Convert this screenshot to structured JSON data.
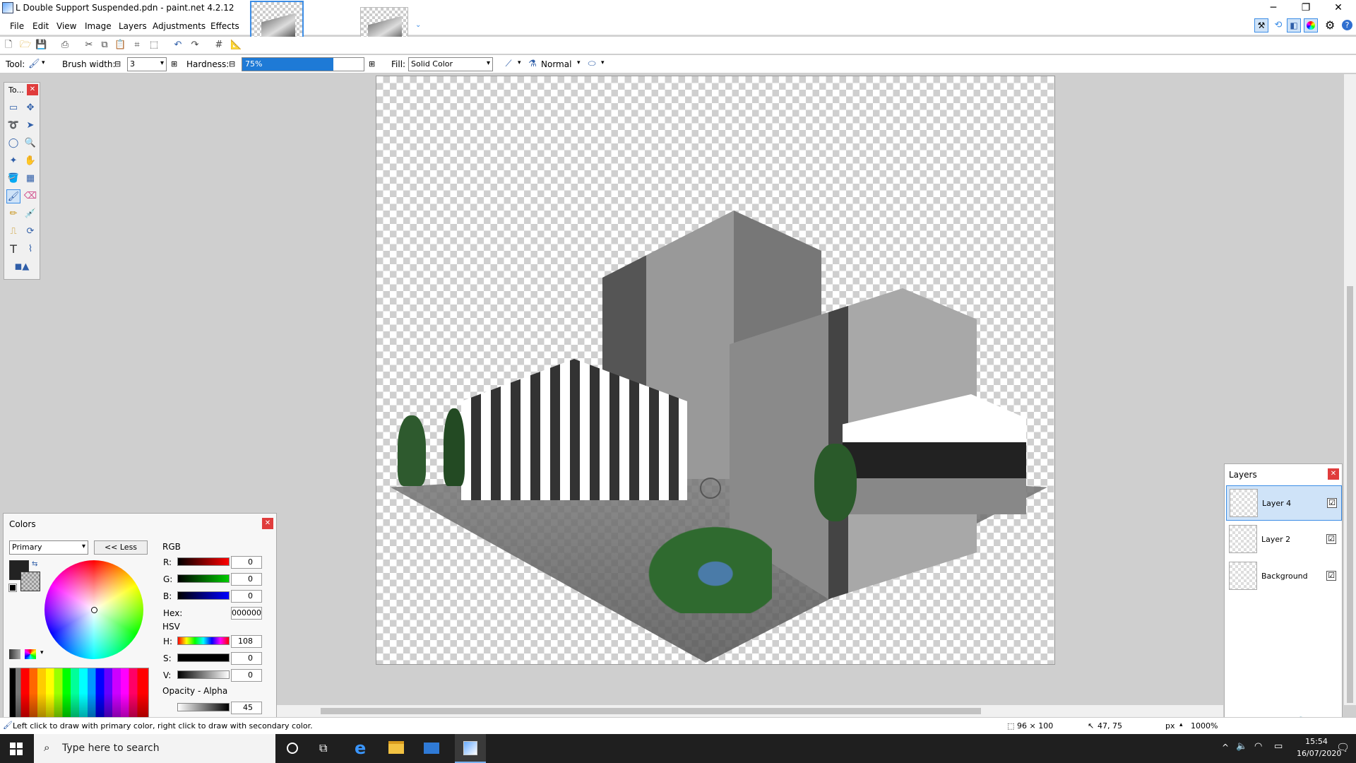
{
  "window": {
    "title": "L Double Support Suspended.pdn - paint.net 4.2.12",
    "min": "─",
    "max": "❐",
    "close": "✕"
  },
  "menu": [
    "File",
    "Edit",
    "View",
    "Image",
    "Layers",
    "Adjustments",
    "Effects"
  ],
  "toolbar": {
    "tool_label": "Tool:",
    "brush_width_label": "Brush width:",
    "brush_width_value": "3",
    "hardness_label": "Hardness:",
    "hardness_value": "75%",
    "hardness_fraction": 0.75,
    "fill_label": "Fill:",
    "fill_value": "Solid Color",
    "blend_mode": "Normal"
  },
  "tools_window": {
    "title": "To..."
  },
  "colors_window": {
    "title": "Colors",
    "mode": "Primary",
    "less_button": "<< Less",
    "rgb_label": "RGB",
    "r_label": "R:",
    "r": "0",
    "g_label": "G:",
    "g": "0",
    "b_label": "B:",
    "b": "0",
    "hex_label": "Hex:",
    "hex": "000000",
    "hsv_label": "HSV",
    "h_label": "H:",
    "h": "108",
    "s_label": "S:",
    "s": "0",
    "v_label": "V:",
    "v": "0",
    "opacity_label": "Opacity - Alpha",
    "opacity": "45"
  },
  "layers_window": {
    "title": "Layers",
    "layers": [
      {
        "name": "Layer 4",
        "checked": "☑"
      },
      {
        "name": "Layer 2",
        "checked": "☑"
      },
      {
        "name": "Background",
        "checked": "☑"
      }
    ]
  },
  "status": {
    "hint": "Left click to draw with primary color, right click to draw with secondary color.",
    "image_size": "96 × 100",
    "cursor_pos": "47, 75",
    "unit": "px",
    "zoom": "1000%"
  },
  "taskbar": {
    "search_placeholder": "Type here to search",
    "time": "15:54",
    "date": "16/07/2020"
  },
  "colors": {
    "accent": "#3c8de6",
    "close_red": "#e03c3c"
  }
}
